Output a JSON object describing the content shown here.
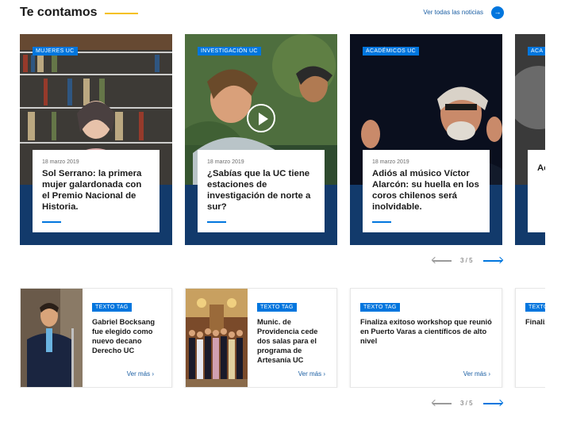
{
  "section": {
    "title": "Te contamos",
    "see_all": "Ver todas las noticias",
    "see_all_icon": "→"
  },
  "featured": {
    "cards": [
      {
        "category": "MUJERES UC",
        "date": "18 marzo 2019",
        "title": "Sol Serrano: la primera mujer galardonada con el Premio Nacional de Historia."
      },
      {
        "category": "INVESTIGACIÓN UC",
        "date": "18 marzo 2019",
        "title": "¿Sabías que la UC tiene estaciones de investigación de norte a sur?"
      },
      {
        "category": "ACADÉMICOS UC",
        "date": "18 marzo 2019",
        "title": "Adiós al músico Víctor Alarcón: su huella en los coros chilenos será inolvidable."
      },
      {
        "category": "ACA",
        "date": "",
        "title": "Ac Al co ine"
      }
    ],
    "pager": "3 / 5"
  },
  "news": {
    "cards": [
      {
        "tag": "TEXTO TAG",
        "title": "Gabriel Bocksang fue elegido como nuevo decano Derecho UC",
        "more": "Ver más  ›"
      },
      {
        "tag": "TEXTO TAG",
        "title": "Munic. de Providencia cede dos salas para el programa de Artesanía UC",
        "more": "Ver más  ›"
      },
      {
        "tag": "TEXTO TAG",
        "title": "Finaliza exitoso workshop que reunió en Puerto Varas a científicos de alto nivel",
        "more": "Ver más  ›"
      },
      {
        "tag": "TEXTO TAG",
        "title": "Finaliz reunió de alto",
        "more": ""
      }
    ],
    "pager": "3 / 5"
  },
  "colors": {
    "accent": "#0176de",
    "highlight": "#f5c013"
  }
}
